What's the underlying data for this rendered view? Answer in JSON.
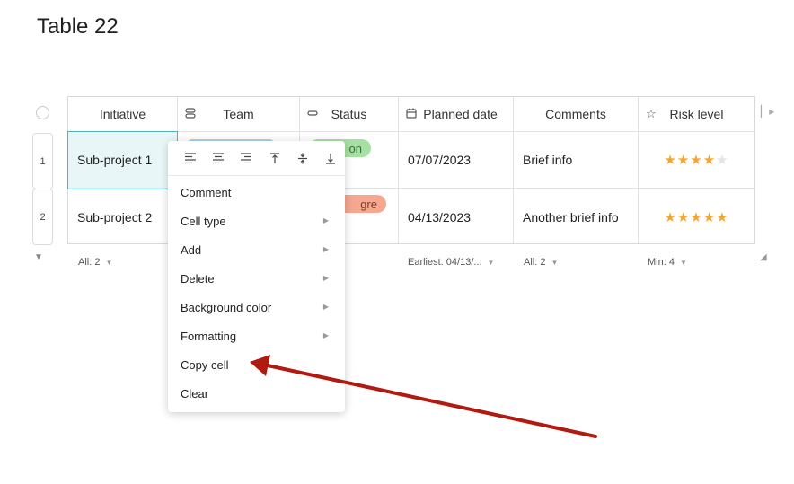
{
  "page": {
    "title": "Table 22"
  },
  "table": {
    "columns": [
      {
        "label": "Initiative",
        "icon": ""
      },
      {
        "label": "Team",
        "icon": "people-icon"
      },
      {
        "label": "Status",
        "icon": "status-icon"
      },
      {
        "label": "Planned date",
        "icon": "calendar-icon"
      },
      {
        "label": "Comments",
        "icon": ""
      },
      {
        "label": "Risk level",
        "icon": "star-icon"
      }
    ],
    "rows": [
      {
        "num": "1",
        "initiative": "Sub-project 1",
        "status": "on",
        "status_color": "#a7e0a3",
        "date": "07/07/2023",
        "comment": "Brief info",
        "risk": 4
      },
      {
        "num": "2",
        "initiative": "Sub-project 2",
        "status": "gre",
        "status_color": "#f5a78f",
        "date": "04/13/2023",
        "comment": "Another brief info",
        "risk": 5
      }
    ],
    "footer": {
      "initiative": "All: 2",
      "date": "Earliest: 04/13/...",
      "comments": "All: 2",
      "risk": "Min: 4"
    },
    "star_color": "#f7a531"
  },
  "context_menu": {
    "toolbar": [
      "align-left-icon",
      "align-center-icon",
      "align-right-icon",
      "align-top-icon",
      "align-middle-icon",
      "align-bottom-icon"
    ],
    "items": [
      {
        "label": "Comment",
        "submenu": false
      },
      {
        "label": "Cell type",
        "submenu": true
      },
      {
        "label": "Add",
        "submenu": true
      },
      {
        "label": "Delete",
        "submenu": true
      },
      {
        "label": "Background color",
        "submenu": true
      },
      {
        "label": "Formatting",
        "submenu": true
      },
      {
        "label": "Copy cell",
        "submenu": false
      },
      {
        "label": "Clear",
        "submenu": false
      }
    ]
  },
  "annotation": {
    "arrow_color": "#b01a10"
  }
}
